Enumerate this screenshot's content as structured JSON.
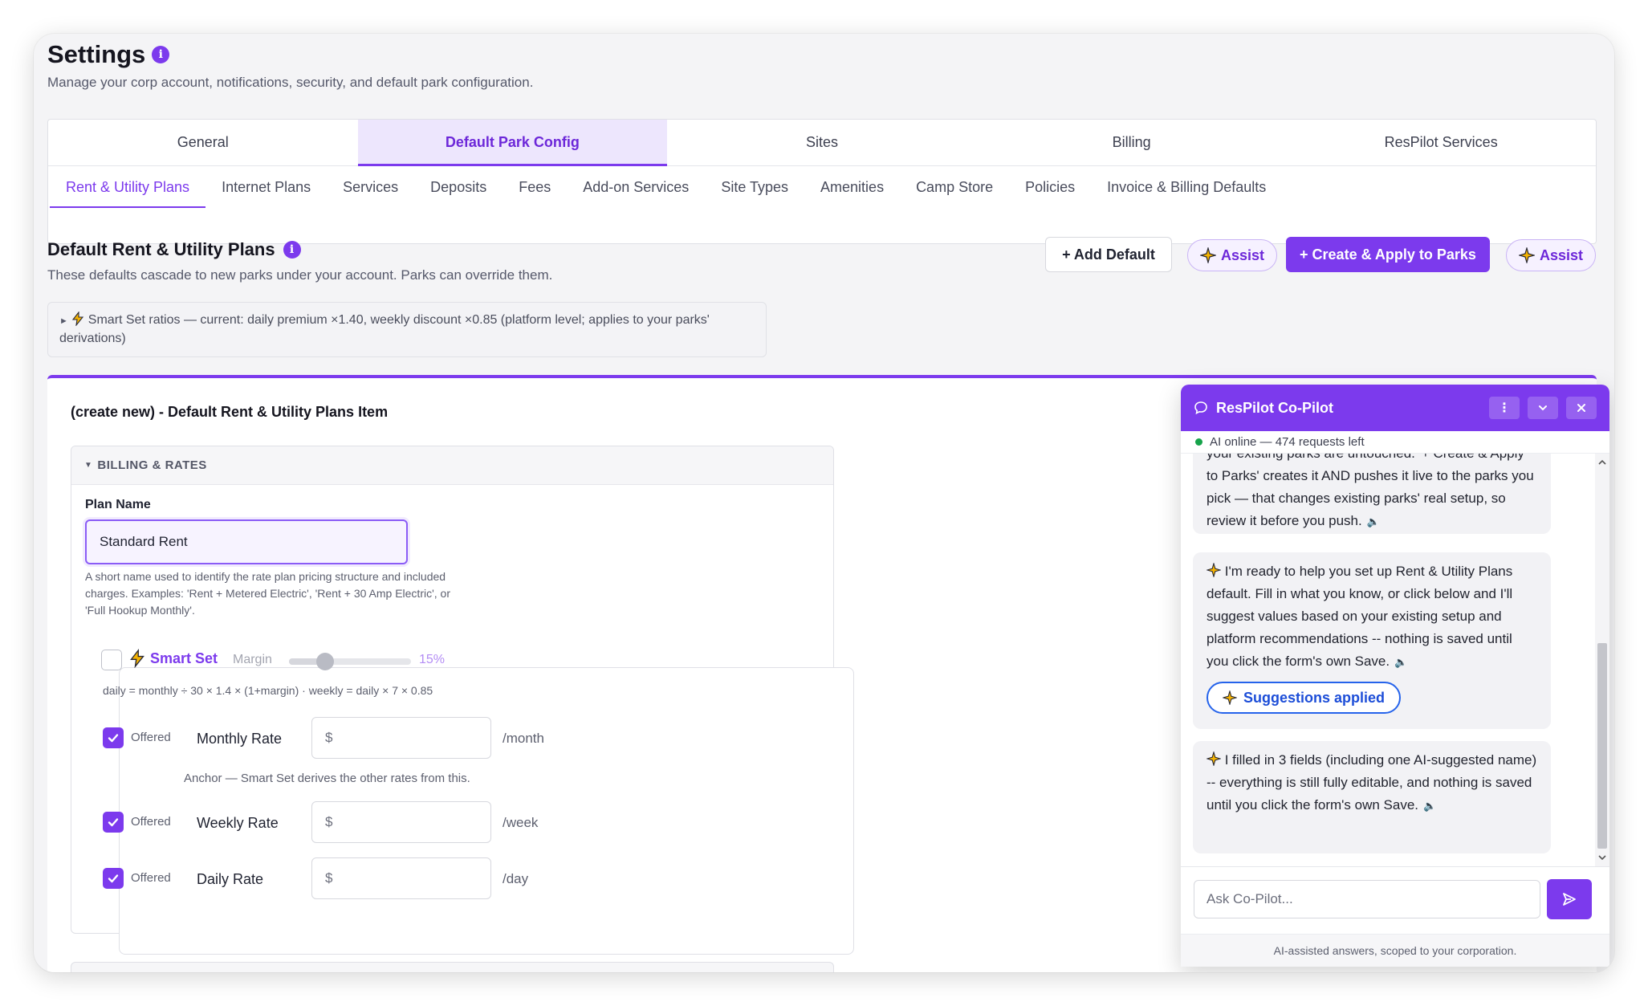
{
  "header": {
    "title": "Settings",
    "subtitle": "Manage your corp account, notifications, security, and default park configuration."
  },
  "tabs": [
    {
      "label": "General"
    },
    {
      "label": "Default Park Config"
    },
    {
      "label": "Sites"
    },
    {
      "label": "Billing"
    },
    {
      "label": "ResPilot Services"
    }
  ],
  "subtabs": [
    {
      "label": "Rent & Utility Plans"
    },
    {
      "label": "Internet Plans"
    },
    {
      "label": "Services"
    },
    {
      "label": "Deposits"
    },
    {
      "label": "Fees"
    },
    {
      "label": "Add-on Services"
    },
    {
      "label": "Site Types"
    },
    {
      "label": "Amenities"
    },
    {
      "label": "Camp Store"
    },
    {
      "label": "Policies"
    },
    {
      "label": "Invoice & Billing Defaults"
    }
  ],
  "section": {
    "title": "Default Rent & Utility Plans",
    "subtitle": "These defaults cascade to new parks under your account. Parks can override them.",
    "add_default": "+ Add Default",
    "assist": "Assist",
    "create_apply": "+ Create & Apply to Parks",
    "ratio_text": "Smart Set ratios — current: daily premium ×1.40, weekly discount ×0.85 (platform level; applies to your parks' derivations)"
  },
  "form": {
    "heading": "(create new) - Default Rent & Utility Plans Item",
    "billing_header": "BILLING & RATES",
    "plan_name_label": "Plan Name",
    "plan_name_value": "Standard Rent",
    "plan_name_help": "A short name used to identify the rate plan pricing structure and included charges. Examples: 'Rent + Metered Electric', 'Rent + 30 Amp Electric', or 'Full Hookup Monthly'.",
    "smart_set": {
      "label": "Smart Set",
      "margin_label": "Margin",
      "margin_value": "15%",
      "margin_fraction": 0.15,
      "formula": "daily = monthly ÷ 30 × 1.4 × (1+margin) · weekly = daily × 7 × 0.85"
    },
    "offered_label": "Offered",
    "currency": "$",
    "rates": [
      {
        "label": "Monthly Rate",
        "unit": "/month",
        "checked": true
      },
      {
        "label": "Weekly Rate",
        "unit": "/week",
        "checked": true
      },
      {
        "label": "Daily Rate",
        "unit": "/day",
        "checked": true
      }
    ],
    "anchor_note": "Anchor — Smart Set derives the other rates from this."
  },
  "copilot": {
    "title": "ResPilot Co-Pilot",
    "status": "AI online — 474 requests left",
    "messages": [
      {
        "text": "your existing parks are untouched. '+ Create & Apply to Parks' creates it AND pushes it live to the parks you pick — that changes existing parks' real setup, so review it before you push."
      },
      {
        "text": "I'm ready to help you set up Rent & Utility Plans default. Fill in what you know, or click below and I'll suggest values based on your existing setup and platform recommendations -- nothing is saved until you click the form's own Save."
      },
      {
        "text": "I filled in 3 fields (including one AI-suggested name) -- everything is still fully editable, and nothing is saved until you click the form's own Save."
      }
    ],
    "suggestions_button": "Suggestions applied",
    "input_placeholder": "Ask Co-Pilot...",
    "footer": "AI-assisted answers, scoped to your corporation."
  },
  "colors": {
    "accent": "#7c3aed",
    "accent_light": "#ede6fd",
    "online": "#16a34a",
    "suggest_blue": "#2563eb"
  },
  "icons": [
    "info-icon",
    "lightning-icon",
    "sparkle-icon",
    "chat-icon",
    "kebab-icon",
    "chevron-down-icon",
    "close-icon",
    "speaker-icon",
    "send-icon",
    "check-icon",
    "caret-right-icon",
    "caret-down-icon"
  ]
}
